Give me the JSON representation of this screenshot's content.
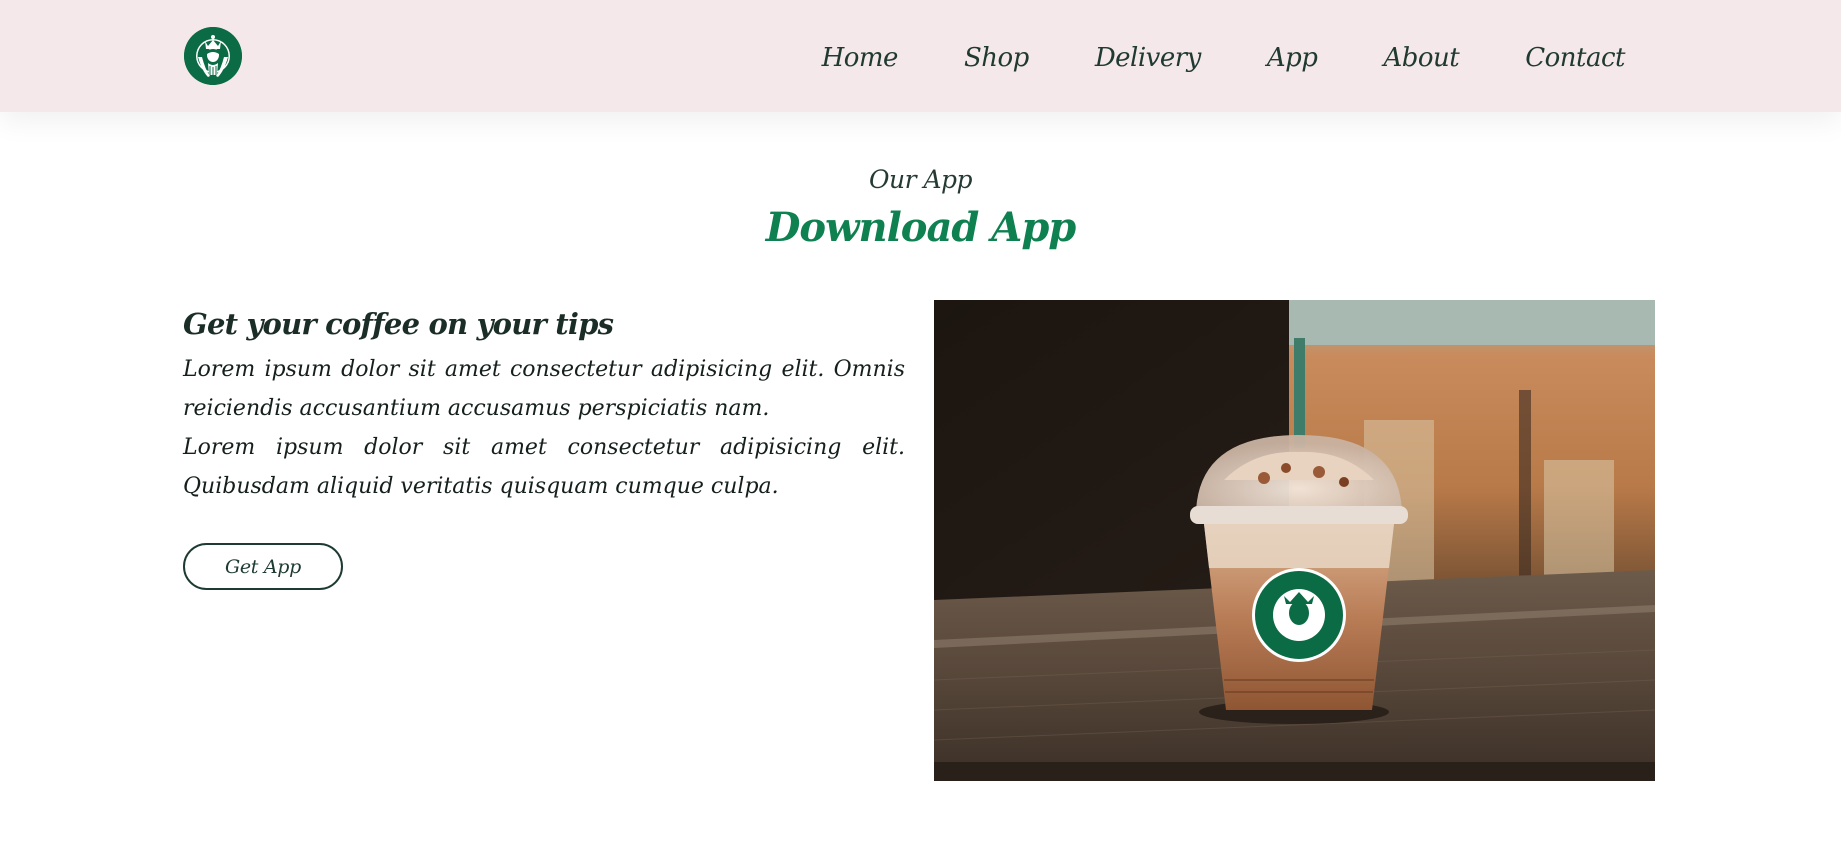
{
  "header": {
    "logo_icon": "siren-logo-icon",
    "brand_color": "#0b6b45",
    "nav": [
      {
        "label": "Home"
      },
      {
        "label": "Shop"
      },
      {
        "label": "Delivery"
      },
      {
        "label": "App"
      },
      {
        "label": "About"
      },
      {
        "label": "Contact"
      }
    ]
  },
  "section": {
    "subtitle": "Our App",
    "title": "Download App",
    "title_color": "#0f8050"
  },
  "content": {
    "heading": "Get your coffee on your tips",
    "paragraph_1": "Lorem ipsum dolor sit amet consectetur adipisicing elit. Omnis reiciendis accusantium accusamus perspiciatis nam.",
    "paragraph_2": "Lorem ipsum dolor sit amet consectetur adipisicing elit. Quibusdam aliquid veritatis quisquam cumque culpa.",
    "button_label": "Get App"
  },
  "image": {
    "subject": "frappuccino-cup-photo"
  }
}
